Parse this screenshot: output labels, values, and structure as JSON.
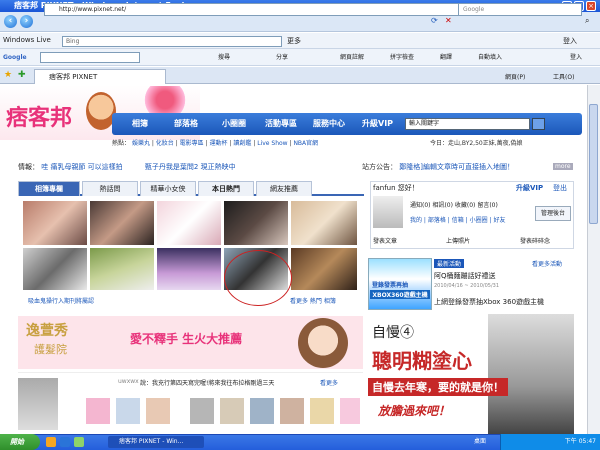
{
  "window": {
    "title": "痞客邦 PIXNET - Windows Internet Explorer",
    "min": "_",
    "max": "□",
    "close": "×"
  },
  "address": {
    "url": "http://www.pixnet.net/",
    "search_placeholder": "Google"
  },
  "livebar": {
    "label": "Windows Live",
    "search_value": "Bing",
    "more": "更多",
    "login": "登入"
  },
  "googlebar": {
    "label": "Google",
    "search": "搜尋",
    "share": "分享",
    "web_annotation": "網頁註解",
    "spell": "拼字檢查",
    "translate": "翻譯",
    "autofill": "自動填入",
    "login": "登入"
  },
  "tab": {
    "label": "痞客邦 PIXNET",
    "page_menu": "網頁(P)",
    "tools_menu": "工具(O)"
  },
  "header": {
    "logo": "痞客邦",
    "nav": [
      "相簿",
      "部落格",
      "小圈圈",
      "活動專區",
      "服務中心",
      "升級VIP"
    ],
    "keyword_placeholder": "輸入關鍵字",
    "hot_label": "熱點：",
    "hot_items": [
      "娛樂丸",
      "化妝台",
      "電影專區",
      "運動杯",
      "讀創鑑",
      "Live Show",
      "NBA官網"
    ],
    "weather": "今日：走山,BY2,50正妹,萬夜,偽娘"
  },
  "ticker": {
    "label": "情報：",
    "text": "哇 痛乳母親節 可以這樣拍",
    "text2": "甄子丹我是葉問2 現正熱映中",
    "site_label": "站方公告：",
    "site_text": "鄭隆格]編輯文章時可直接插入地圖！",
    "more": "more"
  },
  "tabs": [
    "相簿專欄",
    "熱話問",
    "精華小女侠",
    "本日熱門",
    "網友推薦"
  ],
  "photo_caption": "吸血鬼操行入期刊將屬認",
  "photo_more": "看更多 熱門 相簿",
  "login": {
    "greeting": "fanfun 您好！",
    "vip": "升級VIP",
    "logout": "登出",
    "row1": [
      "通知",
      "相訊",
      "收藏",
      "留言"
    ],
    "row1_counts": [
      "(0)",
      "(0)",
      "(0)",
      "(0)"
    ],
    "row2": [
      "我的",
      "部落格",
      "信箱",
      "小圈圈",
      "好友"
    ],
    "admin": "管理後台",
    "post": "發表文章",
    "upload": "上傳照片",
    "publish": "發表碎碎念"
  },
  "activity": {
    "title": "最新活動",
    "more": "看更多活動",
    "item1": "阿Q桶麵蹦話好禮送",
    "item1_date": "2010/04/16 ~ 2010/05/31",
    "item2": "上網登錄發票抽Xbox 360遊戲主機",
    "promo": "XBOX360遊戲主機",
    "promo_top": "登錄發票再抽"
  },
  "banner": {
    "brand": "逸萱秀",
    "brand2": "護髮院",
    "slogan": "愛不釋手 生火大推薦"
  },
  "bigad": {
    "line1": "自慢④",
    "line2": "聰明糊塗心",
    "line3": "自慢去年寒，要的就是你！",
    "line4": "放膽過來吧！"
  },
  "list": {
    "user": "uwxwx",
    "text": "說：我充行第四天寫完喔!將來我往布拉格剛過三天",
    "more": "看更多"
  },
  "taskbar": {
    "start": "開始",
    "task1": "痞客邦 PIXNET - Win...",
    "desktop": "桌面",
    "time": "下午 05:47"
  }
}
